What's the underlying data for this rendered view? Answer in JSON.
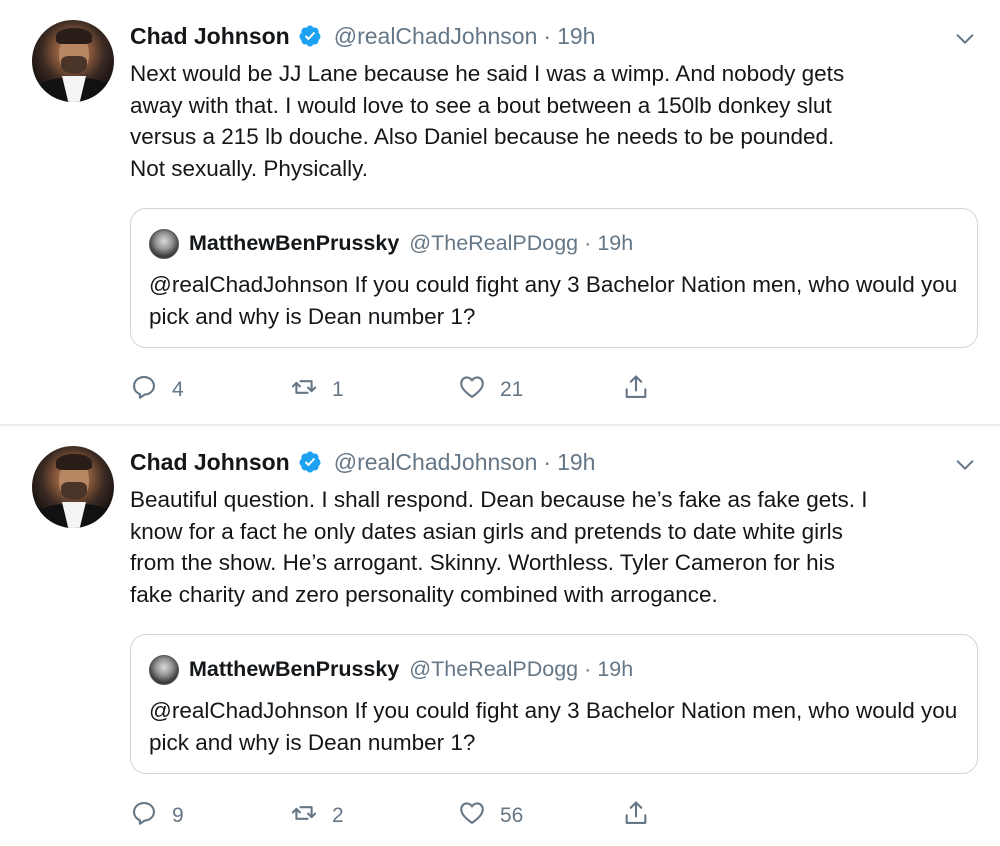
{
  "tweets": [
    {
      "author": {
        "name": "Chad Johnson",
        "handle": "@realChadJohnson",
        "verified": true
      },
      "separator": "·",
      "time": "19h",
      "text": "Next would be JJ Lane because he said I was a wimp. And nobody gets\naway with that. I would love to see a bout between a 150lb donkey slut\nversus a 215 lb douche. Also Daniel because he needs to be pounded.\nNot sexually. Physically.",
      "quote": {
        "name": "MatthewBenPrussky",
        "handle": "@TheRealPDogg",
        "separator": "·",
        "time": "19h",
        "text": "@realChadJohnson If you could fight any 3 Bachelor Nation men, who would you pick and why is Dean number 1?"
      },
      "stats": {
        "replies": "4",
        "retweets": "1",
        "likes": "21"
      }
    },
    {
      "author": {
        "name": "Chad Johnson",
        "handle": "@realChadJohnson",
        "verified": true
      },
      "separator": "·",
      "time": "19h",
      "text": "Beautiful question. I shall respond. Dean because he’s fake as fake gets. I\nknow for a fact he only dates asian girls and pretends to date white girls\nfrom the show. He’s arrogant. Skinny. Worthless. Tyler Cameron for his\nfake charity and zero personality combined with arrogance.",
      "quote": {
        "name": "MatthewBenPrussky",
        "handle": "@TheRealPDogg",
        "separator": "·",
        "time": "19h",
        "text": "@realChadJohnson If you could fight any 3 Bachelor Nation men, who would you pick and why is Dean number 1?"
      },
      "stats": {
        "replies": "9",
        "retweets": "2",
        "likes": "56"
      }
    }
  ],
  "icons": {
    "verified": "verified-badge-icon",
    "more": "chevron-down-icon",
    "reply": "reply-icon",
    "retweet": "retweet-icon",
    "like": "heart-icon",
    "share": "share-icon"
  },
  "colors": {
    "text": "#14171a",
    "secondary": "#657786",
    "verified": "#1da1f2",
    "border": "#ccd6dd",
    "divider": "#e6ecf0"
  }
}
